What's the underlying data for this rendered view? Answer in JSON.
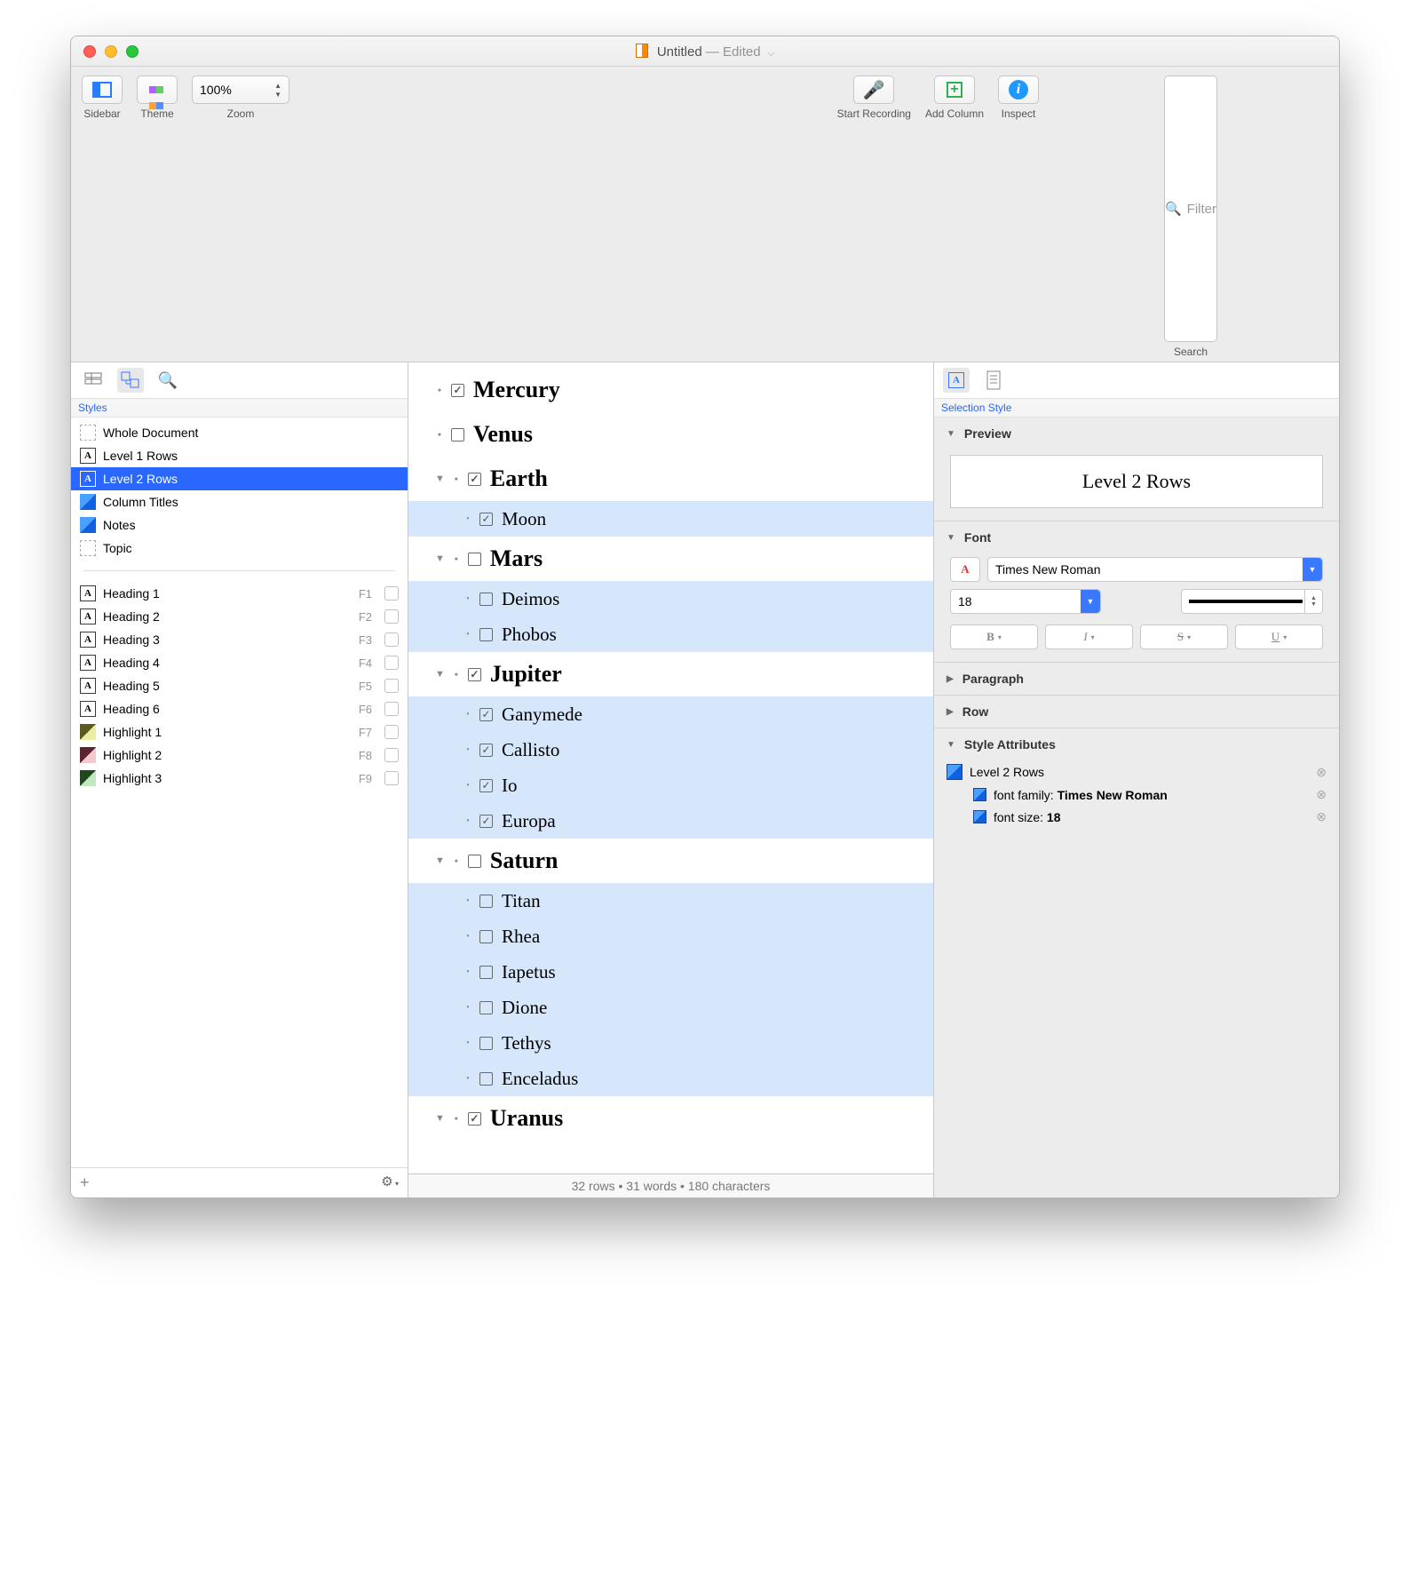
{
  "title": {
    "name": "Untitled",
    "status": "— Edited"
  },
  "toolbar": {
    "sidebar": "Sidebar",
    "theme": "Theme",
    "zoom_value": "100%",
    "zoom_label": "Zoom",
    "record": "Start Recording",
    "addcol": "Add Column",
    "inspect": "Inspect",
    "search_placeholder": "Filter",
    "search_label": "Search"
  },
  "sidebar": {
    "tab_label": "Styles",
    "base": [
      {
        "label": "Whole Document",
        "icon": "dashed"
      },
      {
        "label": "Level 1 Rows",
        "icon": "A"
      },
      {
        "label": "Level 2 Rows",
        "icon": "A",
        "selected": true
      },
      {
        "label": "Column Titles",
        "icon": "blue"
      },
      {
        "label": "Notes",
        "icon": "blue"
      },
      {
        "label": "Topic",
        "icon": "dashed"
      }
    ],
    "named": [
      {
        "label": "Heading 1",
        "key": "F1",
        "icon": "A"
      },
      {
        "label": "Heading 2",
        "key": "F2",
        "icon": "A"
      },
      {
        "label": "Heading 3",
        "key": "F3",
        "icon": "A"
      },
      {
        "label": "Heading 4",
        "key": "F4",
        "icon": "A"
      },
      {
        "label": "Heading 5",
        "key": "F5",
        "icon": "A"
      },
      {
        "label": "Heading 6",
        "key": "F6",
        "icon": "A"
      },
      {
        "label": "Highlight 1",
        "key": "F7",
        "icon": "hl1"
      },
      {
        "label": "Highlight 2",
        "key": "F8",
        "icon": "hl2"
      },
      {
        "label": "Highlight 3",
        "key": "F9",
        "icon": "hl3"
      }
    ]
  },
  "outline": {
    "rows": [
      {
        "level": 1,
        "label": "Mercury",
        "checked": true,
        "expandable": false,
        "selected": false
      },
      {
        "level": 1,
        "label": "Venus",
        "checked": false,
        "expandable": false,
        "selected": false
      },
      {
        "level": 1,
        "label": "Earth",
        "checked": true,
        "expandable": true,
        "selected": false
      },
      {
        "level": 2,
        "label": "Moon",
        "checked": true,
        "selected": true
      },
      {
        "level": 1,
        "label": "Mars",
        "checked": false,
        "expandable": true,
        "selected": false
      },
      {
        "level": 2,
        "label": "Deimos",
        "checked": false,
        "selected": true
      },
      {
        "level": 2,
        "label": "Phobos",
        "checked": false,
        "selected": true
      },
      {
        "level": 1,
        "label": "Jupiter",
        "checked": true,
        "expandable": true,
        "selected": false
      },
      {
        "level": 2,
        "label": "Ganymede",
        "checked": true,
        "selected": true
      },
      {
        "level": 2,
        "label": "Callisto",
        "checked": true,
        "selected": true
      },
      {
        "level": 2,
        "label": "Io",
        "checked": true,
        "selected": true
      },
      {
        "level": 2,
        "label": "Europa",
        "checked": true,
        "selected": true
      },
      {
        "level": 1,
        "label": "Saturn",
        "checked": false,
        "expandable": true,
        "selected": false
      },
      {
        "level": 2,
        "label": "Titan",
        "checked": false,
        "selected": true
      },
      {
        "level": 2,
        "label": "Rhea",
        "checked": false,
        "selected": true
      },
      {
        "level": 2,
        "label": "Iapetus",
        "checked": false,
        "selected": true
      },
      {
        "level": 2,
        "label": "Dione",
        "checked": false,
        "selected": true
      },
      {
        "level": 2,
        "label": "Tethys",
        "checked": false,
        "selected": true
      },
      {
        "level": 2,
        "label": "Enceladus",
        "checked": false,
        "selected": true
      },
      {
        "level": 1,
        "label": "Uranus",
        "checked": true,
        "expandable": true,
        "selected": false
      }
    ],
    "status": "32 rows • 31 words • 180 characters"
  },
  "inspector": {
    "tab_label": "Selection Style",
    "preview_heading": "Preview",
    "preview_text": "Level 2 Rows",
    "font_heading": "Font",
    "font_family": "Times New Roman",
    "font_size": "18",
    "para_heading": "Paragraph",
    "row_heading": "Row",
    "attr_heading": "Style Attributes",
    "attr_style": "Level 2 Rows",
    "attr1_label": "font family: ",
    "attr1_value": "Times New Roman",
    "attr2_label": "font size: ",
    "attr2_value": "18"
  }
}
